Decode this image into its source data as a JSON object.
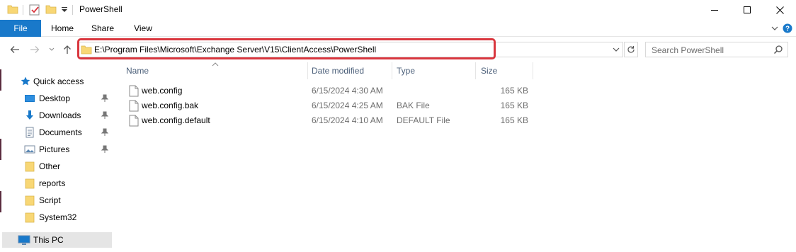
{
  "window": {
    "title": "PowerShell",
    "minimize_glyph": "—",
    "maximize_glyph": "☐",
    "close_glyph": "✕"
  },
  "ribbon": {
    "tabs": [
      "File",
      "Home",
      "Share",
      "View"
    ]
  },
  "address_bar": {
    "path": "E:\\Program Files\\Microsoft\\Exchange Server\\V15\\ClientAccess\\PowerShell",
    "highlight_color": "#d9363e"
  },
  "search": {
    "placeholder": "Search PowerShell"
  },
  "nav_pane": {
    "items": [
      {
        "label": "Quick access",
        "icon": "star-icon",
        "pinned": false
      },
      {
        "label": "Desktop",
        "icon": "desktop-icon",
        "pinned": true
      },
      {
        "label": "Downloads",
        "icon": "download-icon",
        "pinned": true
      },
      {
        "label": "Documents",
        "icon": "documents-icon",
        "pinned": true
      },
      {
        "label": "Pictures",
        "icon": "pictures-icon",
        "pinned": true
      },
      {
        "label": "Other",
        "icon": "folder-icon",
        "pinned": false
      },
      {
        "label": "reports",
        "icon": "folder-icon",
        "pinned": false
      },
      {
        "label": "Script",
        "icon": "folder-icon",
        "pinned": false
      },
      {
        "label": "System32",
        "icon": "folder-icon",
        "pinned": false
      },
      {
        "label": "This PC",
        "icon": "computer-icon",
        "pinned": false
      }
    ]
  },
  "file_list": {
    "columns": [
      "Name",
      "Date modified",
      "Type",
      "Size"
    ],
    "rows": [
      {
        "name": "web.config",
        "date": "6/15/2024 4:30 AM",
        "type": "",
        "size": "165 KB"
      },
      {
        "name": "web.config.bak",
        "date": "6/15/2024 4:25 AM",
        "type": "BAK File",
        "size": "165 KB"
      },
      {
        "name": "web.config.default",
        "date": "6/15/2024 4:10 AM",
        "type": "DEFAULT File",
        "size": "165 KB"
      }
    ]
  },
  "colors": {
    "file_tab": "#1979ca",
    "folder_yellow": "#f8d775",
    "selection": "#e5e5e5",
    "accent_blue": "#1979ca"
  }
}
